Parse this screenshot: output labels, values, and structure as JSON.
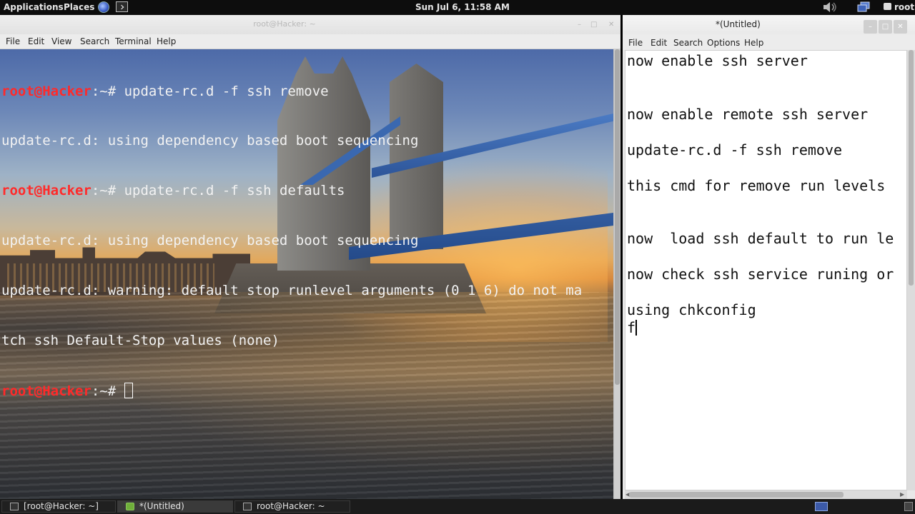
{
  "top_panel": {
    "applications": "Applications",
    "places": "Places",
    "clock": "Sun Jul  6, 11:58 AM",
    "user": "root"
  },
  "terminal": {
    "title": "root@Hacker: ~",
    "menu": [
      "File",
      "Edit",
      "View",
      "Search",
      "Terminal",
      "Help"
    ],
    "lines": [
      {
        "user": "root@Hacker",
        "path": ":~# ",
        "cmd": "update-rc.d -f ssh remove"
      },
      {
        "text": "update-rc.d: using dependency based boot sequencing"
      },
      {
        "user": "root@Hacker",
        "path": ":~# ",
        "cmd": "update-rc.d -f ssh defaults"
      },
      {
        "text": "update-rc.d: using dependency based boot sequencing"
      },
      {
        "text": "update-rc.d: warning: default stop runlevel arguments (0 1 6) do not ma"
      },
      {
        "text": "tch ssh Default-Stop values (none)"
      },
      {
        "user": "root@Hacker",
        "path": ":~# ",
        "cmd": ""
      }
    ]
  },
  "gedit": {
    "title": "*(Untitled)",
    "menu": [
      "File",
      "Edit",
      "Search",
      "Options",
      "Help"
    ],
    "lines": [
      "now enable ssh server",
      "now enable remote ssh server",
      "update-rc.d -f ssh remove",
      "this cmd for remove run levels",
      "now  load ssh default to run le",
      "now check ssh service runing or",
      "using chkconfig",
      "f"
    ]
  },
  "taskbar": {
    "tasks": [
      "[root@Hacker: ~]",
      "*(Untitled)",
      "root@Hacker: ~"
    ]
  }
}
